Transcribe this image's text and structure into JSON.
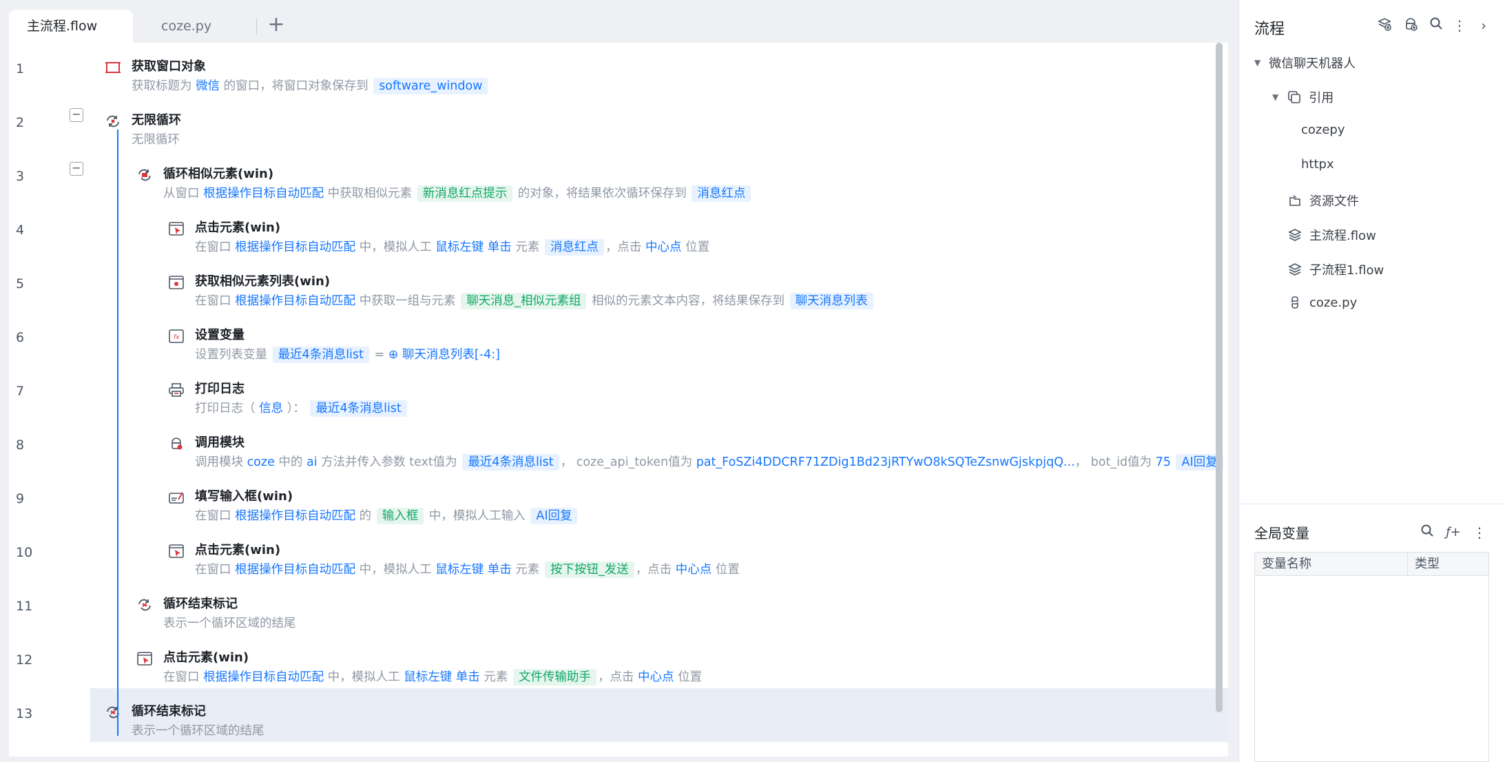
{
  "tabs": [
    {
      "label": "主流程.flow",
      "active": true
    },
    {
      "label": "coze.py",
      "active": false
    }
  ],
  "tab_add_label": "+",
  "steps": [
    {
      "line": "1",
      "title": "获取窗口对象",
      "icon": "window-icon",
      "desc": [
        {
          "t": "获取标题为 "
        },
        {
          "t": "微信",
          "k": "link"
        },
        {
          "t": " 的窗口，将窗口对象保存到 "
        },
        {
          "t": "software_window",
          "k": "tag-b"
        }
      ]
    },
    {
      "line": "2",
      "title": "无限循环",
      "icon": "infinite-loop-icon",
      "fold": true,
      "desc": [
        {
          "t": "无限循环"
        }
      ]
    },
    {
      "line": "3",
      "title": "循环相似元素(win)",
      "icon": "loop-elements-icon",
      "fold": true,
      "desc": [
        {
          "t": "从窗口 "
        },
        {
          "t": "根据操作目标自动匹配",
          "k": "link"
        },
        {
          "t": " 中获取相似元素 "
        },
        {
          "t": "新消息红点提示",
          "k": "tag-g"
        },
        {
          "t": " 的对象，将结果依次循环保存到 "
        },
        {
          "t": "消息红点",
          "k": "tag-b"
        }
      ]
    },
    {
      "line": "4",
      "title": "点击元素(win)",
      "icon": "click-element-icon",
      "desc": [
        {
          "t": "在窗口 "
        },
        {
          "t": "根据操作目标自动匹配",
          "k": "link"
        },
        {
          "t": " 中，模拟人工 "
        },
        {
          "t": "鼠标左键",
          "k": "link"
        },
        {
          "t": " "
        },
        {
          "t": "单击",
          "k": "link"
        },
        {
          "t": " 元素 "
        },
        {
          "t": "消息红点",
          "k": "tag-b"
        },
        {
          "t": "，点击 "
        },
        {
          "t": "中心点",
          "k": "link"
        },
        {
          "t": " 位置"
        }
      ]
    },
    {
      "line": "5",
      "title": "获取相似元素列表(win)",
      "icon": "element-list-icon",
      "desc": [
        {
          "t": "在窗口 "
        },
        {
          "t": "根据操作目标自动匹配",
          "k": "link"
        },
        {
          "t": " 中获取一组与元素 "
        },
        {
          "t": "聊天消息_相似元素组",
          "k": "tag-g"
        },
        {
          "t": " 相似的元素文本内容，将结果保存到 "
        },
        {
          "t": "聊天消息列表",
          "k": "tag-b"
        }
      ]
    },
    {
      "line": "6",
      "title": "设置变量",
      "icon": "set-variable-icon",
      "desc": [
        {
          "t": "设置列表变量 "
        },
        {
          "t": "最近4条消息list",
          "k": "tag-b"
        },
        {
          "t": " = "
        },
        {
          "t": "⊕ 聊天消息列表[-4:]",
          "k": "link"
        }
      ]
    },
    {
      "line": "7",
      "title": "打印日志",
      "icon": "print-log-icon",
      "desc": [
        {
          "t": "打印日志（ "
        },
        {
          "t": "信息",
          "k": "link"
        },
        {
          "t": " ）： "
        },
        {
          "t": "最近4条消息list",
          "k": "tag-b"
        }
      ]
    },
    {
      "line": "8",
      "title": "调用模块",
      "icon": "call-module-icon",
      "desc": [
        {
          "t": "调用模块 "
        },
        {
          "t": "coze",
          "k": "link"
        },
        {
          "t": " 中的 "
        },
        {
          "t": "ai",
          "k": "link"
        },
        {
          "t": " 方法并传入参数 text值为 "
        },
        {
          "t": "最近4条消息list",
          "k": "tag-b"
        },
        {
          "t": "， coze_api_token值为 "
        },
        {
          "t": "pat_FoSZi4DDCRF71ZDig1Bd23jRTYwO8kSQTeZsnwGjskpjqQ...",
          "k": "link"
        },
        {
          "t": "， bot_id值为 "
        },
        {
          "t": "75",
          "k": "link"
        },
        {
          "t": " "
        },
        {
          "t": "AI回复",
          "k": "tag-b"
        }
      ]
    },
    {
      "line": "9",
      "title": "填写输入框(win)",
      "icon": "fill-input-icon",
      "desc": [
        {
          "t": "在窗口 "
        },
        {
          "t": "根据操作目标自动匹配",
          "k": "link"
        },
        {
          "t": " 的 "
        },
        {
          "t": "输入框",
          "k": "tag-g"
        },
        {
          "t": " 中，模拟人工输入 "
        },
        {
          "t": "AI回复",
          "k": "tag-b"
        }
      ]
    },
    {
      "line": "10",
      "title": "点击元素(win)",
      "icon": "click-element-icon",
      "desc": [
        {
          "t": "在窗口 "
        },
        {
          "t": "根据操作目标自动匹配",
          "k": "link"
        },
        {
          "t": " 中，模拟人工 "
        },
        {
          "t": "鼠标左键",
          "k": "link"
        },
        {
          "t": " "
        },
        {
          "t": "单击",
          "k": "link"
        },
        {
          "t": " 元素 "
        },
        {
          "t": "按下按钮_发送",
          "k": "tag-g"
        },
        {
          "t": "，点击 "
        },
        {
          "t": "中心点",
          "k": "link"
        },
        {
          "t": " 位置"
        }
      ]
    },
    {
      "line": "11",
      "title": "循环结束标记",
      "icon": "loop-end-icon",
      "desc": [
        {
          "t": "表示一个循环区域的结尾"
        }
      ]
    },
    {
      "line": "12",
      "title": "点击元素(win)",
      "icon": "click-element-icon",
      "desc": [
        {
          "t": "在窗口 "
        },
        {
          "t": "根据操作目标自动匹配",
          "k": "link"
        },
        {
          "t": " 中，模拟人工 "
        },
        {
          "t": "鼠标左键",
          "k": "link"
        },
        {
          "t": " "
        },
        {
          "t": "单击",
          "k": "link"
        },
        {
          "t": " 元素 "
        },
        {
          "t": "文件传输助手",
          "k": "tag-g"
        },
        {
          "t": "，点击 "
        },
        {
          "t": "中心点",
          "k": "link"
        },
        {
          "t": " 位置"
        }
      ]
    },
    {
      "line": "13",
      "title": "循环结束标记",
      "icon": "loop-end-icon",
      "selected": true,
      "desc": [
        {
          "t": "表示一个循环区域的结尾"
        }
      ]
    }
  ],
  "panel": {
    "title": "流程",
    "tree": {
      "root": "微信聊天机器人",
      "refs": "引用",
      "ref_items": [
        "cozepy",
        "httpx"
      ],
      "items": [
        {
          "label": "资源文件",
          "icon": "resource-folder-icon"
        },
        {
          "label": "主流程.flow",
          "icon": "flow-layers-icon"
        },
        {
          "label": "子流程1.flow",
          "icon": "flow-layers-icon"
        },
        {
          "label": "coze.py",
          "icon": "python-icon"
        }
      ]
    },
    "globals_title": "全局变量",
    "table_headers": [
      "变量名称",
      "类型"
    ]
  },
  "colors": {
    "accent": "#1677ff",
    "green": "#10a865",
    "icon_red": "#d9363e"
  }
}
